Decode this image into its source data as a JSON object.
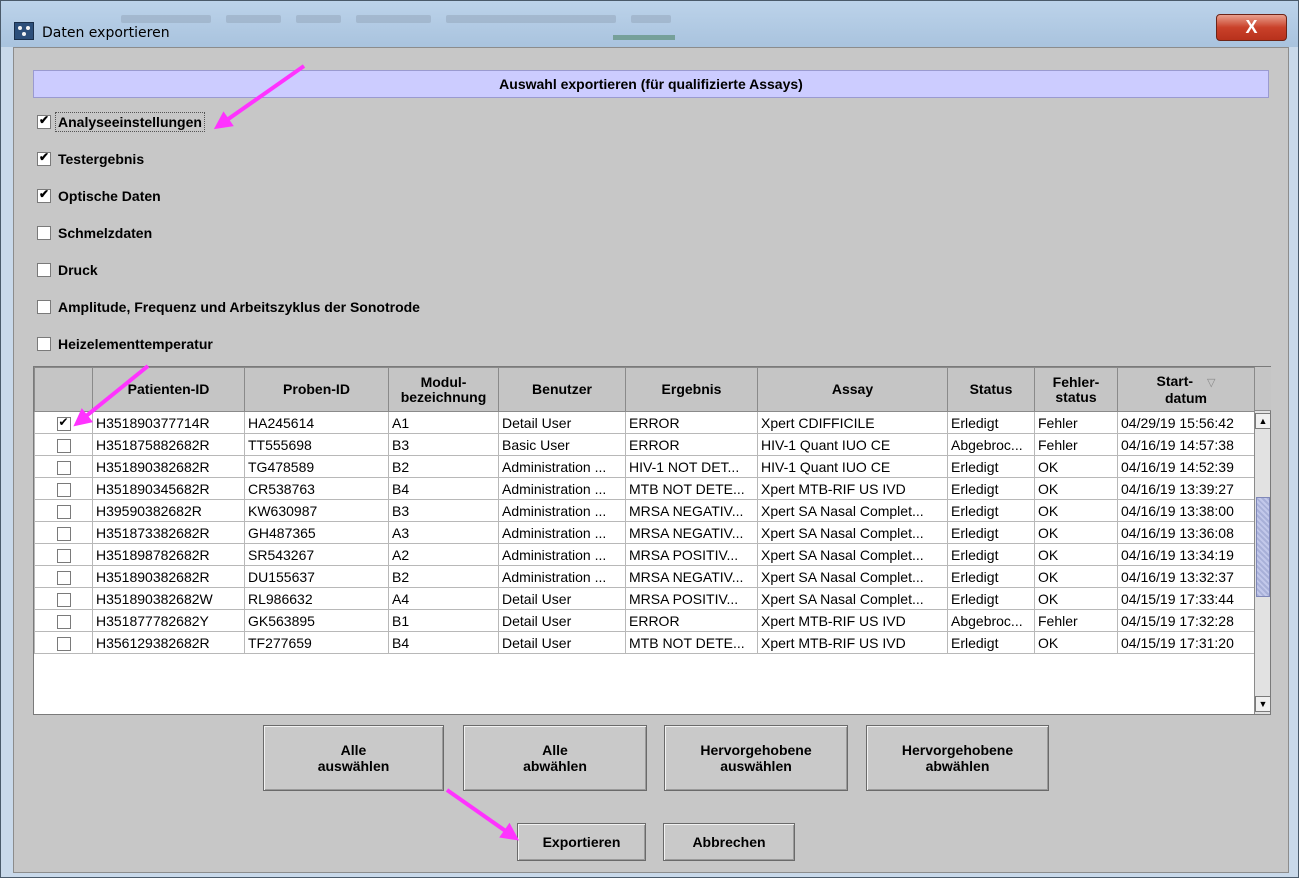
{
  "window": {
    "title": "Daten exportieren",
    "close_label": "X"
  },
  "section": {
    "header": "Auswahl exportieren (für qualifizierte Assays)"
  },
  "options": [
    {
      "label": "Analyseeinstellungen",
      "checked": true
    },
    {
      "label": "Testergebnis",
      "checked": true
    },
    {
      "label": "Optische Daten",
      "checked": true
    },
    {
      "label": "Schmelzdaten",
      "checked": false
    },
    {
      "label": "Druck",
      "checked": false
    },
    {
      "label": "Amplitude, Frequenz und Arbeitszyklus der Sonotrode",
      "checked": false
    },
    {
      "label": "Heizelementtemperatur",
      "checked": false
    }
  ],
  "table": {
    "headers": {
      "patient": "Patienten-ID",
      "sample": "Proben-ID",
      "module_1": "Modul-",
      "module_2": "bezeichnung",
      "user": "Benutzer",
      "result": "Ergebnis",
      "assay": "Assay",
      "status": "Status",
      "error_1": "Fehler-",
      "error_2": "status",
      "start_1": "Start-",
      "start_2": "datum"
    },
    "rows": [
      {
        "checked": true,
        "patient": "H351890377714R",
        "sample": "HA245614",
        "module": "A1",
        "user": "Detail User",
        "result": "ERROR",
        "assay": "Xpert CDIFFICILE",
        "status": "Erledigt",
        "error": "Fehler",
        "start": "04/29/19 15:56:42"
      },
      {
        "checked": false,
        "patient": "H351875882682R",
        "sample": "TT555698",
        "module": "B3",
        "user": "Basic User",
        "result": "ERROR",
        "assay": "HIV-1 Quant IUO CE",
        "status": "Abgebroc...",
        "error": "Fehler",
        "start": "04/16/19 14:57:38"
      },
      {
        "checked": false,
        "patient": "H351890382682R",
        "sample": "TG478589",
        "module": "B2",
        "user": "Administration ...",
        "result": "HIV-1 NOT DET...",
        "assay": "HIV-1 Quant IUO CE",
        "status": "Erledigt",
        "error": "OK",
        "start": "04/16/19 14:52:39"
      },
      {
        "checked": false,
        "patient": "H351890345682R",
        "sample": "CR538763",
        "module": "B4",
        "user": "Administration ...",
        "result": "MTB NOT DETE...",
        "assay": "Xpert MTB-RIF US IVD",
        "status": "Erledigt",
        "error": "OK",
        "start": "04/16/19 13:39:27"
      },
      {
        "checked": false,
        "patient": "H39590382682R",
        "sample": "KW630987",
        "module": "B3",
        "user": "Administration ...",
        "result": "MRSA NEGATIV...",
        "assay": "Xpert SA Nasal Complet...",
        "status": "Erledigt",
        "error": "OK",
        "start": "04/16/19 13:38:00"
      },
      {
        "checked": false,
        "patient": "H351873382682R",
        "sample": "GH487365",
        "module": "A3",
        "user": "Administration ...",
        "result": "MRSA NEGATIV...",
        "assay": "Xpert SA Nasal Complet...",
        "status": "Erledigt",
        "error": "OK",
        "start": "04/16/19 13:36:08"
      },
      {
        "checked": false,
        "patient": "H351898782682R",
        "sample": "SR543267",
        "module": "A2",
        "user": "Administration ...",
        "result": "MRSA POSITIV...",
        "assay": "Xpert SA Nasal Complet...",
        "status": "Erledigt",
        "error": "OK",
        "start": "04/16/19 13:34:19"
      },
      {
        "checked": false,
        "patient": "H351890382682R",
        "sample": "DU155637",
        "module": "B2",
        "user": "Administration ...",
        "result": "MRSA NEGATIV...",
        "assay": "Xpert SA Nasal Complet...",
        "status": "Erledigt",
        "error": "OK",
        "start": "04/16/19 13:32:37"
      },
      {
        "checked": false,
        "patient": "H351890382682W",
        "sample": "RL986632",
        "module": "A4",
        "user": "Detail User",
        "result": "MRSA POSITIV...",
        "assay": "Xpert SA Nasal Complet...",
        "status": "Erledigt",
        "error": "OK",
        "start": "04/15/19 17:33:44"
      },
      {
        "checked": false,
        "patient": "H351877782682Y",
        "sample": "GK563895",
        "module": "B1",
        "user": "Detail User",
        "result": "ERROR",
        "assay": "Xpert MTB-RIF US IVD",
        "status": "Abgebroc...",
        "error": "Fehler",
        "start": "04/15/19 17:32:28"
      },
      {
        "checked": false,
        "patient": "H356129382682R",
        "sample": "TF277659",
        "module": "B4",
        "user": "Detail User",
        "result": "MTB NOT DETE...",
        "assay": "Xpert MTB-RIF US IVD",
        "status": "Erledigt",
        "error": "OK",
        "start": "04/15/19 17:31:20"
      }
    ]
  },
  "buttons": {
    "select_all_1": "Alle",
    "select_all_2": "auswählen",
    "deselect_all_1": "Alle",
    "deselect_all_2": "abwählen",
    "select_highlighted_1": "Hervorgehobene",
    "select_highlighted_2": "auswählen",
    "deselect_highlighted_1": "Hervorgehobene",
    "deselect_highlighted_2": "abwählen",
    "export": "Exportieren",
    "cancel": "Abbrechen"
  },
  "colors": {
    "annotation_arrow": "#ff33ff",
    "section_header_bg": "#ccccff",
    "close_button": "#c9412a"
  }
}
